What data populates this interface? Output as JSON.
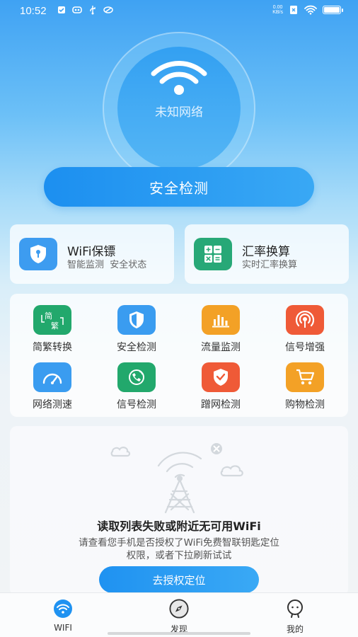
{
  "status_bar": {
    "time": "10:52",
    "net_speed_value": "0.00",
    "net_speed_unit": "KB/s"
  },
  "hero": {
    "network_name": "未知网络",
    "primary_button": "安全检测"
  },
  "feature_cards": [
    {
      "title": "WiFi保镖",
      "subtitle": "智能监测  安全状态",
      "icon": "shield-lock-icon",
      "color": "#3d9cf0"
    },
    {
      "title": "汇率换算",
      "subtitle": "实时汇率换算",
      "icon": "calculator-icon",
      "color": "#27a877"
    }
  ],
  "tools": [
    {
      "label": "简繁转换",
      "icon": "simplified-traditional-icon",
      "color": "#22a86c"
    },
    {
      "label": "安全检测",
      "icon": "shield-icon",
      "color": "#3a9cf0"
    },
    {
      "label": "流量监测",
      "icon": "bar-chart-icon",
      "color": "#f3a126"
    },
    {
      "label": "信号增强",
      "icon": "signal-broadcast-icon",
      "color": "#ef5a37"
    },
    {
      "label": "网络测速",
      "icon": "speedometer-icon",
      "color": "#3a9cf0"
    },
    {
      "label": "信号检测",
      "icon": "satellite-icon",
      "color": "#22a86c"
    },
    {
      "label": "蹭网检测",
      "icon": "shield-check-icon",
      "color": "#ef5a37"
    },
    {
      "label": "购物检测",
      "icon": "shopping-cart-icon",
      "color": "#f3a126"
    }
  ],
  "empty_state": {
    "title": "读取列表失败或附近无可用WiFi",
    "message": "请查看您手机是否授权了WiFi免费智联钥匙定位权限，或者下拉刷新试试",
    "button": "去授权定位"
  },
  "tabbar": [
    {
      "label": "WIFI",
      "icon": "wifi-icon",
      "active": true
    },
    {
      "label": "发现",
      "icon": "compass-icon",
      "active": false
    },
    {
      "label": "我的",
      "icon": "user-icon",
      "active": false
    }
  ],
  "colors": {
    "accent": "#1f92f1"
  }
}
